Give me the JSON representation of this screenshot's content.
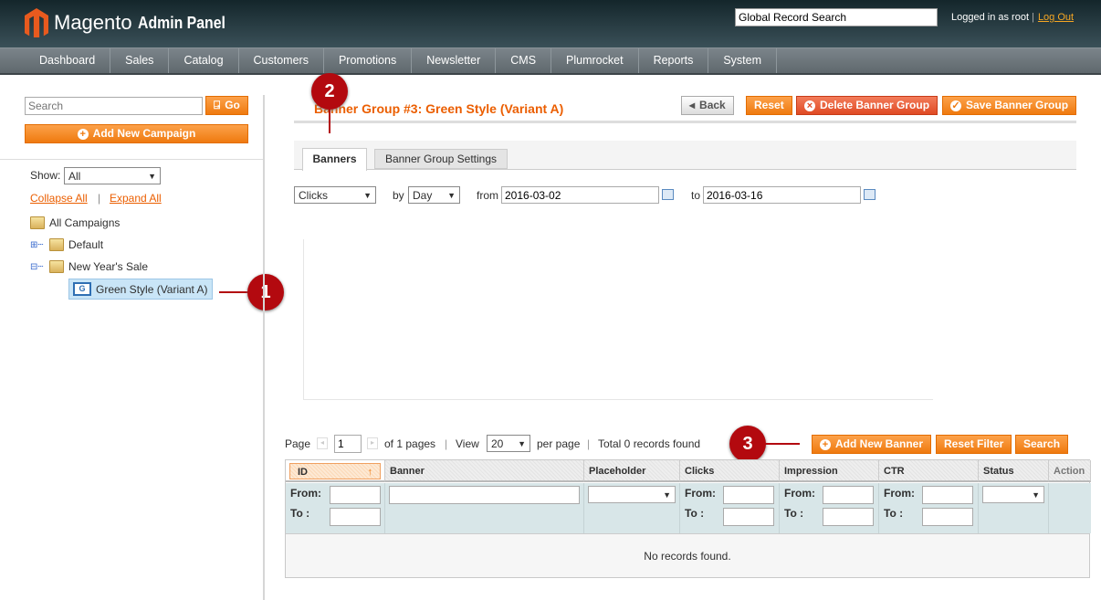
{
  "header": {
    "brand": "Magento",
    "subtitle": "Admin Panel",
    "search_value": "Global Record Search",
    "logged_in": "Logged in as root",
    "separator": "|",
    "logout": "Log Out"
  },
  "nav": [
    "Dashboard",
    "Sales",
    "Catalog",
    "Customers",
    "Promotions",
    "Newsletter",
    "CMS",
    "Plumrocket",
    "Reports",
    "System"
  ],
  "sidebar": {
    "search_placeholder": "Search",
    "go": "Go",
    "add_campaign": "Add New Campaign",
    "show_label": "Show:",
    "show_value": "All",
    "collapse": "Collapse All",
    "sep": "|",
    "expand": "Expand All",
    "tree": [
      "All Campaigns",
      "Default",
      "New Year's Sale",
      "Green Style (Variant A)"
    ]
  },
  "main": {
    "title": "Banner Group #3: Green Style (Variant A)",
    "back": "Back",
    "reset": "Reset",
    "delete": "Delete Banner Group",
    "save": "Save Banner Group",
    "tabs": [
      "Banners",
      "Banner Group Settings"
    ],
    "filter": {
      "metric": "Clicks",
      "by_label": "by",
      "by_value": "Day",
      "from_label": "from",
      "from_value": "2016-03-02",
      "to_label": "to",
      "to_value": "2016-03-16"
    },
    "pager": {
      "page_label": "Page",
      "page": "1",
      "of": "of 1 pages",
      "view_label": "View",
      "view": "20",
      "per_page": "per page",
      "total": "Total 0 records found"
    },
    "add_banner": "Add New Banner",
    "reset_filter": "Reset Filter",
    "search": "Search",
    "columns": [
      "ID",
      "Banner",
      "Placeholder",
      "Clicks",
      "Impression",
      "CTR",
      "Status",
      "Action"
    ],
    "from_label": "From:",
    "to_label": "To :",
    "empty": "No records found."
  },
  "callouts": [
    "1",
    "2",
    "3"
  ],
  "colors": {
    "accent": "#ef7a0f",
    "callout": "#b3090f",
    "title": "#eb5e00"
  }
}
